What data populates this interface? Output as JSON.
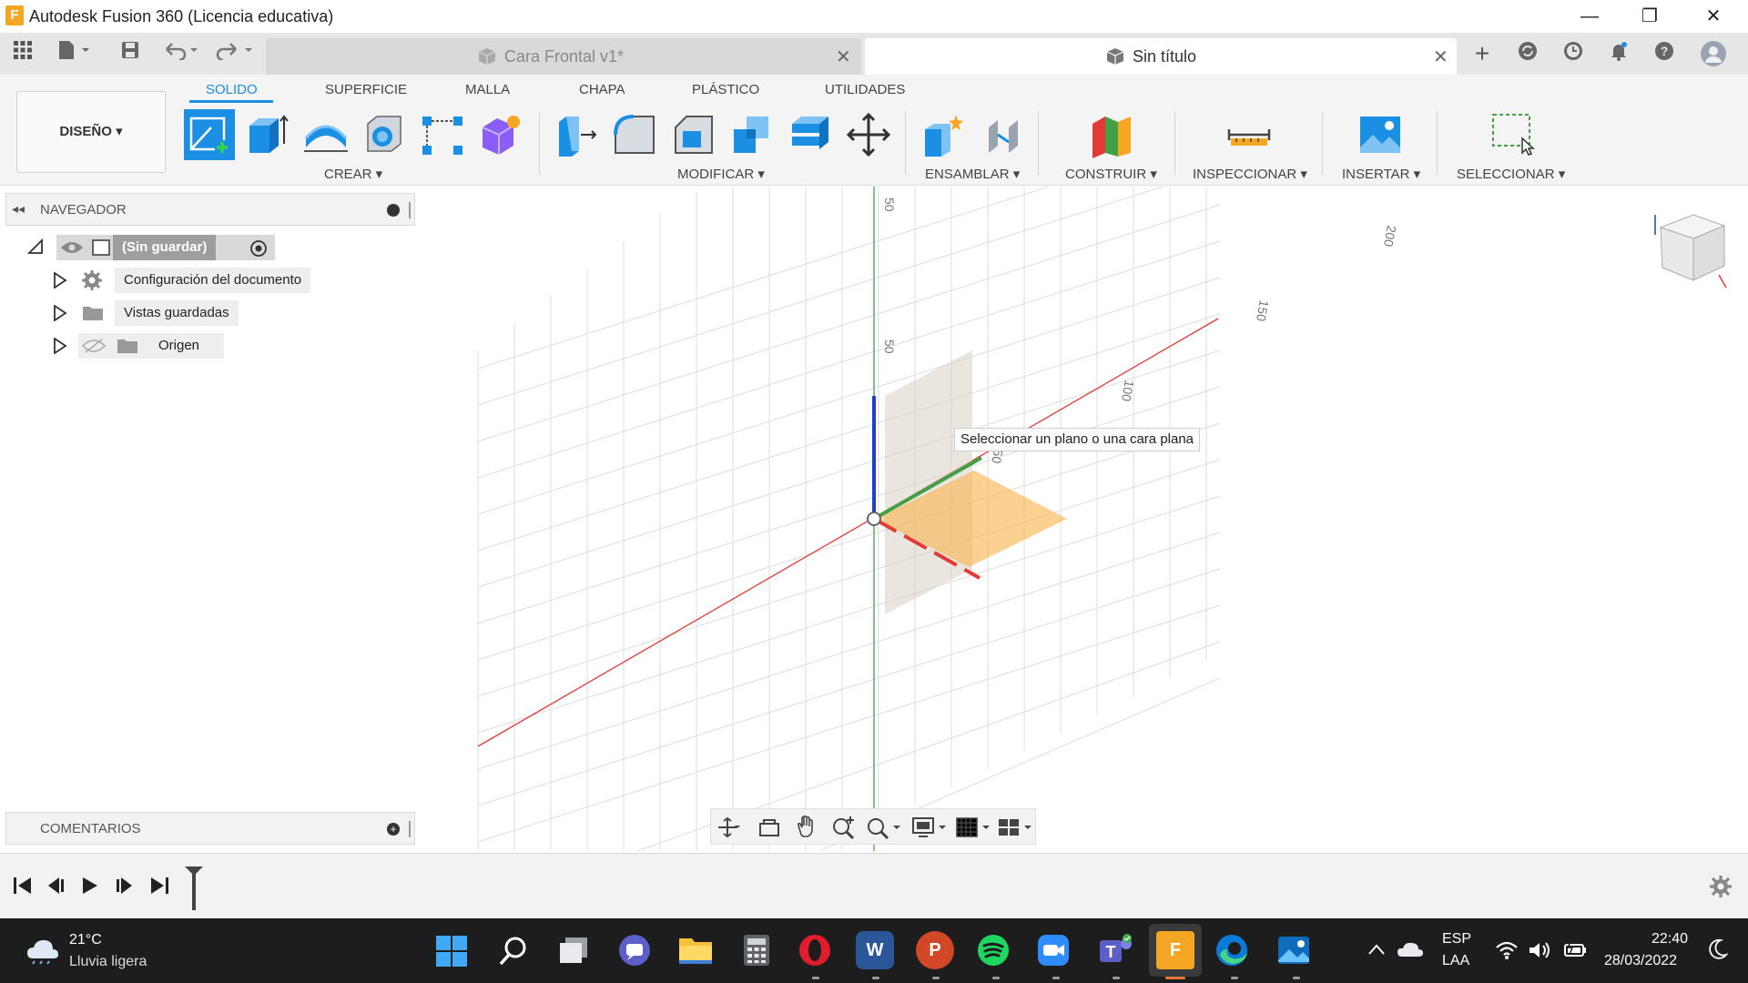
{
  "window": {
    "title": "Autodesk Fusion 360 (Licencia educativa)",
    "app_icon_letter": "F",
    "minimize_glyph": "—",
    "maximize_glyph": "❐",
    "close_glyph": "✕"
  },
  "tabs": [
    {
      "label": "Cara Frontal v1*",
      "active": false
    },
    {
      "label": "Sin título",
      "active": true
    }
  ],
  "tab_close_glyph": "✕",
  "new_tab_glyph": "+",
  "ribbon": {
    "workspace_button": "DISEÑO ▾",
    "tabs": [
      "SOLIDO",
      "SUPERFICIE",
      "MALLA",
      "CHAPA",
      "PLÁSTICO",
      "UTILIDADES"
    ],
    "active_tab": "SOLIDO",
    "groups": [
      "CREAR ▾",
      "MODIFICAR ▾",
      "ENSAMBLAR ▾",
      "CONSTRUIR ▾",
      "INSPECCIONAR ▾",
      "INSERTAR ▾",
      "SELECCIONAR ▾"
    ]
  },
  "navigator": {
    "title": "NAVEGADOR",
    "root": "(Sin guardar)",
    "items": [
      "Configuración del documento",
      "Vistas guardadas",
      "Origen"
    ]
  },
  "comments": {
    "title": "COMENTARIOS"
  },
  "viewport": {
    "tooltip": "Seleccionar un plano o una cara plana",
    "grid_labels": [
      "50",
      "50",
      "100",
      "150",
      "200",
      "50"
    ]
  },
  "taskbar": {
    "weather_temp": "21°C",
    "weather_desc": "Lluvia ligera",
    "lang_top": "ESP",
    "lang_bottom": "LAA",
    "time": "22:40",
    "date": "28/03/2022",
    "apps": [
      {
        "name": "word",
        "letter": "W",
        "color": "#2b579a"
      },
      {
        "name": "powerpoint",
        "letter": "P",
        "color": "#d24726"
      },
      {
        "name": "fusion",
        "letter": "F",
        "color": "#f5a623"
      }
    ]
  },
  "colors": {
    "accent": "#1a8fe3",
    "axis_red": "#e53935",
    "axis_green": "#43a047",
    "axis_blue": "#1e40c8",
    "plane_orange": "#f9b34a",
    "taskbar": "#1d1d1d"
  }
}
